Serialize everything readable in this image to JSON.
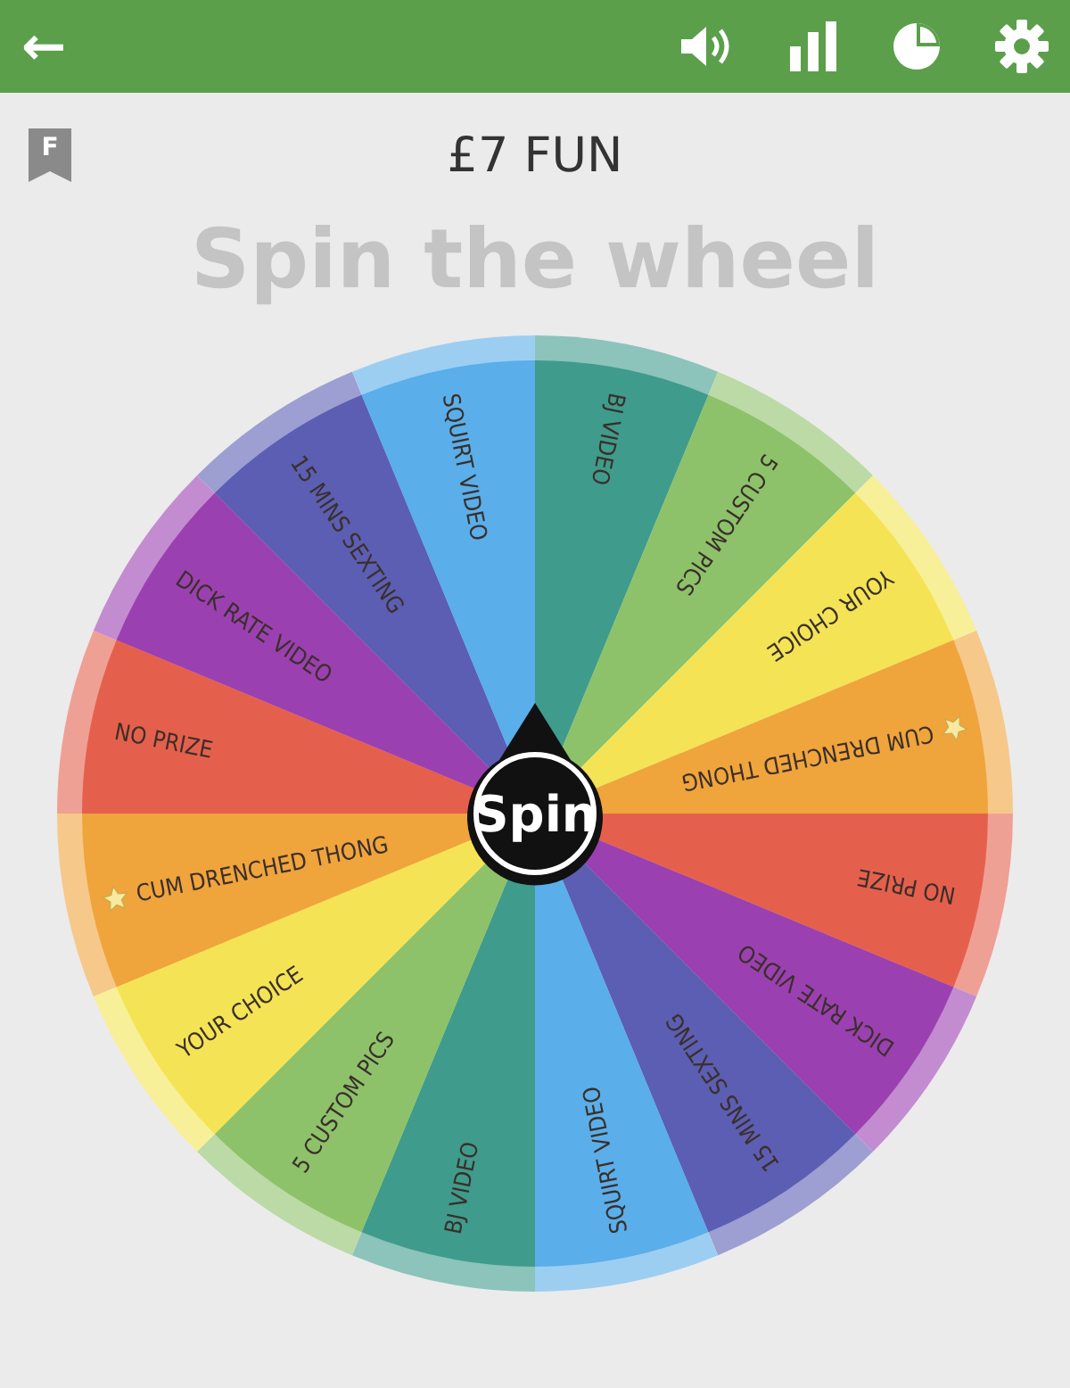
{
  "top_bar": {
    "back": "←"
  },
  "header": {
    "badge": "F",
    "title": "£7 FUN"
  },
  "heading": "Spin the wheel",
  "wheel": {
    "button": "Spin",
    "segments": [
      {
        "label": "BJ VIDEO",
        "color": "#3f9b8c",
        "starred": false
      },
      {
        "label": "5 CUSTOM PICS",
        "color": "#8dc26a",
        "starred": false
      },
      {
        "label": "YOUR CHOICE",
        "color": "#f4e455",
        "starred": false
      },
      {
        "label": "CUM DRENCHED THONG",
        "color": "#f0a43c",
        "starred": true
      },
      {
        "label": "NO PRIZE",
        "color": "#e5604c",
        "starred": false
      },
      {
        "label": "DICK RATE VIDEO",
        "color": "#9b40b0",
        "starred": false
      },
      {
        "label": "15 MINS SEXTING",
        "color": "#5b5eb2",
        "starred": false
      },
      {
        "label": "SQUIRT VIDEO",
        "color": "#5aaee9",
        "starred": false
      },
      {
        "label": "BJ VIDEO",
        "color": "#3f9b8c",
        "starred": false
      },
      {
        "label": "5 CUSTOM PICS",
        "color": "#8dc26a",
        "starred": false
      },
      {
        "label": "YOUR CHOICE",
        "color": "#f4e455",
        "starred": false
      },
      {
        "label": "CUM DRENCHED THONG",
        "color": "#f0a43c",
        "starred": true
      },
      {
        "label": "NO PRIZE",
        "color": "#e5604c",
        "starred": false
      },
      {
        "label": "DICK RATE VIDEO",
        "color": "#9b40b0",
        "starred": false
      },
      {
        "label": "15 MINS SEXTING",
        "color": "#5b5eb2",
        "starred": false
      },
      {
        "label": "SQUIRT VIDEO",
        "color": "#5aaee9",
        "starred": false
      }
    ]
  }
}
